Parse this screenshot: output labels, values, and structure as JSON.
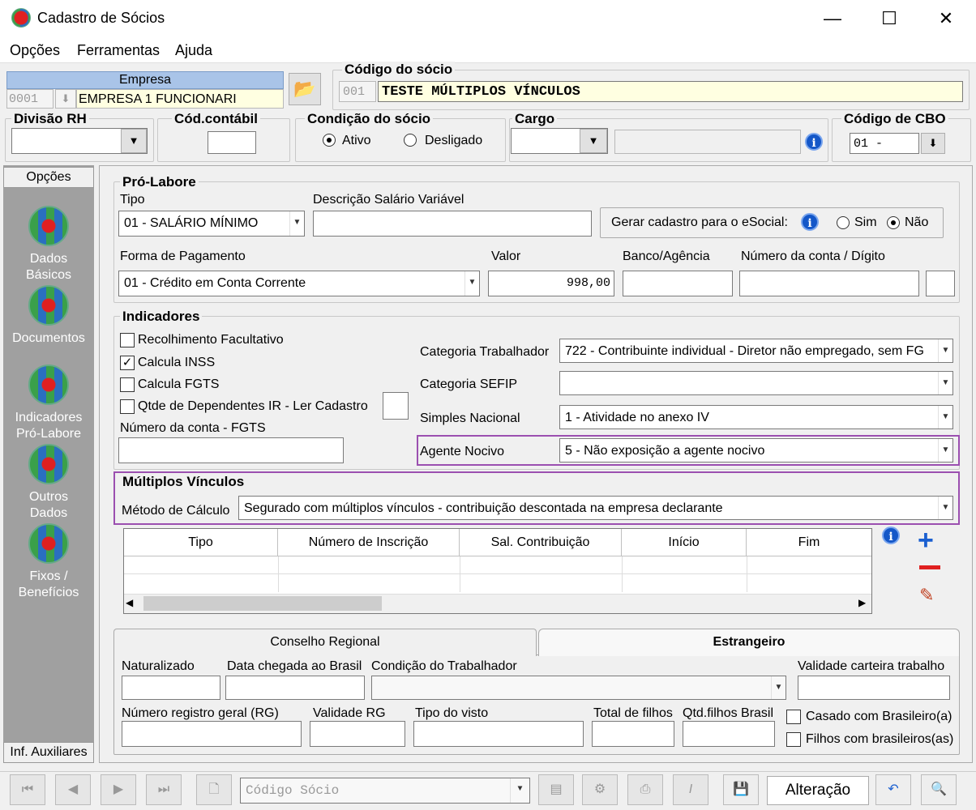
{
  "window": {
    "title": "Cadastro de Sócios",
    "min": "—",
    "max": "☐",
    "close": "✕"
  },
  "menu": [
    "Opções",
    "Ferramentas",
    "Ajuda"
  ],
  "empresa": {
    "label": "Empresa",
    "code": "0001",
    "name": "EMPRESA 1 FUNCIONARI"
  },
  "socio": {
    "label": "Código do sócio",
    "code": "001",
    "name": "TESTE MÚLTIPLOS VÍNCULOS"
  },
  "divisao": {
    "label": "Divisão RH"
  },
  "contabil": {
    "label": "Cód.contábil"
  },
  "condicao": {
    "label": "Condição do sócio",
    "ativo": "Ativo",
    "desligado": "Desligado"
  },
  "cargo": {
    "label": "Cargo"
  },
  "cbo": {
    "label": "Código de CBO",
    "value": "01  -"
  },
  "sidebar": {
    "head": "Opções",
    "items": [
      {
        "line1": "Dados",
        "line2": "Básicos"
      },
      {
        "line1": "Documentos",
        "line2": ""
      },
      {
        "line1": "Indicadores",
        "line2": "Pró-Labore"
      },
      {
        "line1": "Outros",
        "line2": "Dados"
      },
      {
        "line1": "Fixos /",
        "line2": "Benefícios"
      }
    ],
    "foot": "Inf. Auxiliares"
  },
  "prolabore": {
    "title": "Pró-Labore",
    "tipo_label": "Tipo",
    "tipo": "01 - SALÁRIO MÍNIMO",
    "desc_label": "Descrição Salário Variável",
    "esocial_label": "Gerar cadastro para o eSocial:",
    "sim": "Sim",
    "nao": "Não",
    "forma_label": "Forma de Pagamento",
    "forma": "01 - Crédito em Conta Corrente",
    "valor_label": "Valor",
    "valor": "998,00",
    "banco_label": "Banco/Agência",
    "conta_label": "Número da conta / Dígito"
  },
  "indicadores": {
    "title": "Indicadores",
    "recolhimento": "Recolhimento Facultativo",
    "inss": "Calcula INSS",
    "fgts": "Calcula FGTS",
    "dependentes": "Qtde de Dependentes IR - Ler Cadastro",
    "contafgts_label": "Número da conta - FGTS",
    "cat_trab_label": "Categoria Trabalhador",
    "cat_trab": "722 - Contribuinte individual - Diretor não empregado, sem FG",
    "cat_sefip_label": "Categoria SEFIP",
    "simples_label": "Simples Nacional",
    "simples": "1 - Atividade no anexo IV",
    "agente_label": "Agente Nocivo",
    "agente": "5 - Não exposição a agente nocivo"
  },
  "multiplos": {
    "title": "Múltiplos Vínculos",
    "metodo_label": "Método de Cálculo",
    "metodo": "Segurado com múltiplos vínculos - contribuição descontada na empresa declarante",
    "columns": [
      "Tipo",
      "Número de Inscrição",
      "Sal. Contribuição",
      "Início",
      "Fim"
    ]
  },
  "tabs": {
    "conselho": "Conselho Regional",
    "estrangeiro": "Estrangeiro"
  },
  "estrangeiro": {
    "naturalizado": "Naturalizado",
    "chegada": "Data chegada ao Brasil",
    "condicao": "Condição do Trabalhador",
    "validade_ct": "Validade carteira trabalho",
    "rg": "Número registro geral (RG)",
    "validade_rg": "Validade RG",
    "visto": "Tipo do visto",
    "filhos": "Total de filhos",
    "filhos_br": "Qtd.filhos Brasil",
    "casado": "Casado com Brasileiro(a)",
    "filhos_com": "Filhos com brasileiros(as)"
  },
  "bottom": {
    "search_placeholder": "Código Sócio",
    "status": "Alteração"
  }
}
